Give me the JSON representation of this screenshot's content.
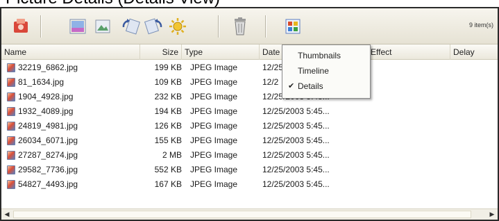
{
  "caption": "Picture Details (Details View)",
  "toolbar": {
    "buttons": [
      {
        "name": "import-icon",
        "color": "#d9473a"
      },
      {
        "name": "edit-icon",
        "color": "#6a8fd0"
      },
      {
        "name": "photo-icon",
        "color": "#5aa06a"
      },
      {
        "name": "rotate-left-icon",
        "color": "#4d6fb5"
      },
      {
        "name": "rotate-right-icon",
        "color": "#4d6fb5"
      },
      {
        "name": "slideshow-icon",
        "color": "#e0b020"
      },
      {
        "name": "delete-icon",
        "color": "#8a8a8a"
      },
      {
        "name": "views-icon",
        "color": "#d84a2b"
      }
    ],
    "item_count": "9 item(s)"
  },
  "columns": {
    "name": "Name",
    "size": "Size",
    "type": "Type",
    "date": "Date",
    "effect": "Effect",
    "delay": "Delay"
  },
  "files": [
    {
      "name": "32219_6862.jpg",
      "size": "199 KB",
      "type": "JPEG Image",
      "date": "12/25/2003 5:45..."
    },
    {
      "name": "81_1634.jpg",
      "size": "109 KB",
      "type": "JPEG Image",
      "date": "12/2"
    },
    {
      "name": "1904_4928.jpg",
      "size": "232 KB",
      "type": "JPEG Image",
      "date": "12/25/2003 5:45..."
    },
    {
      "name": "1932_4089.jpg",
      "size": "194 KB",
      "type": "JPEG Image",
      "date": "12/25/2003 5:45..."
    },
    {
      "name": "24819_4981.jpg",
      "size": "126 KB",
      "type": "JPEG Image",
      "date": "12/25/2003 5:45..."
    },
    {
      "name": "26034_6071.jpg",
      "size": "155 KB",
      "type": "JPEG Image",
      "date": "12/25/2003 5:45..."
    },
    {
      "name": "27287_8274.jpg",
      "size": "2 MB",
      "type": "JPEG Image",
      "date": "12/25/2003 5:45..."
    },
    {
      "name": "29582_7736.jpg",
      "size": "552 KB",
      "type": "JPEG Image",
      "date": "12/25/2003 5:45..."
    },
    {
      "name": "54827_4493.jpg",
      "size": "167 KB",
      "type": "JPEG Image",
      "date": "12/25/2003 5:45..."
    }
  ],
  "view_menu": {
    "items": [
      {
        "label": "Thumbnails",
        "checked": false
      },
      {
        "label": "Timeline",
        "checked": false
      },
      {
        "label": "Details",
        "checked": true
      }
    ]
  }
}
